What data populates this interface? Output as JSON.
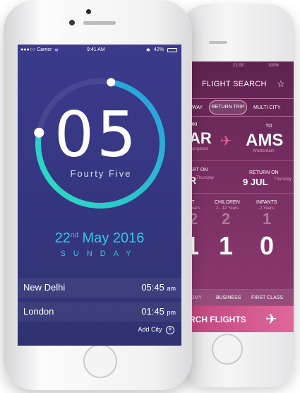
{
  "clock_app": {
    "status": {
      "carrier": "●●●○○ Carrier",
      "time": "9:41 AM",
      "battery": "42%"
    },
    "hour": "05",
    "minutes_words": "Fourty Five",
    "date_day": "22",
    "date_suffix": "nd",
    "date_rest": "May 2016",
    "weekday": "SUNDAY",
    "progress_fraction": 0.75,
    "cities": [
      {
        "name": "New Delhi",
        "time": "05:45",
        "period": "am"
      },
      {
        "name": "London",
        "time": "01:45",
        "period": "pm"
      }
    ],
    "add_city": "Add City",
    "colors": {
      "accent": "#34c6e8",
      "ring_start": "#2de0c0",
      "ring_end": "#2a9be0",
      "bg": "#35367f"
    }
  },
  "flight_app": {
    "status": {
      "time": "22:08",
      "battery": "100%"
    },
    "title": "FLIGHT SEARCH",
    "trip_types": [
      "WAY",
      "RETURN TRIP",
      "MULTI CITY"
    ],
    "from_label": "OM",
    "from_code": "AR",
    "from_city": "Bangalore",
    "to_label": "TO",
    "to_code": "AMS",
    "to_city": "Amsterdam",
    "depart_label": "ART ON",
    "depart_value": "R",
    "depart_day": "Thursday",
    "return_label": "RETURN ON",
    "return_value": "9 JUL",
    "return_day": "Thursday",
    "adult_label": "LT",
    "adult_sub": "Years",
    "children_label": "CHILDREN",
    "children_sub": "2 - 12 Years",
    "infants_label": "INFANTS",
    "infants_sub": "-2 Years",
    "counts": {
      "adult_top": "2",
      "adult": "1",
      "children_top": "2",
      "children": "1",
      "infants_top": "1",
      "infants": "0"
    },
    "classes": [
      "OMY",
      "BUSINESS",
      "FIRST CLASS"
    ],
    "search_label": "RCH FLIGHTS",
    "colors": {
      "bg": "#7a2f63",
      "button": "#d45a8f"
    }
  }
}
